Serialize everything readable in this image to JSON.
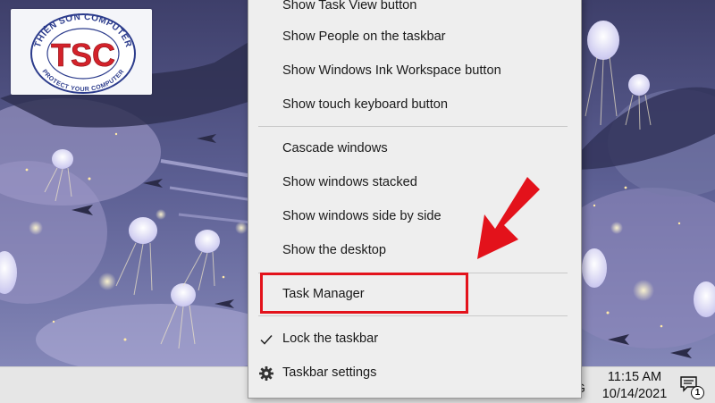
{
  "logo": {
    "abbrev": "TSC",
    "arc_top": "THIÊN SƠN COMPUTER",
    "arc_bottom": "PROTECT YOUR COMPUTER"
  },
  "context_menu": {
    "items": [
      {
        "label": "Show Task View button"
      },
      {
        "label": "Show People on the taskbar"
      },
      {
        "label": "Show Windows Ink Workspace button"
      },
      {
        "label": "Show touch keyboard button"
      },
      {
        "label": "Cascade windows"
      },
      {
        "label": "Show windows stacked"
      },
      {
        "label": "Show windows side by side"
      },
      {
        "label": "Show the desktop"
      },
      {
        "label": "Task Manager"
      },
      {
        "label": "Lock the taskbar",
        "icon": "checkmark-icon"
      },
      {
        "label": "Taskbar settings",
        "icon": "gear-icon"
      }
    ]
  },
  "annotation": {
    "color": "#e3121b"
  },
  "taskbar": {
    "tray_edge_text": "G",
    "clock_time": "11:15 AM",
    "clock_date": "10/14/2021",
    "notification_count": "1"
  }
}
